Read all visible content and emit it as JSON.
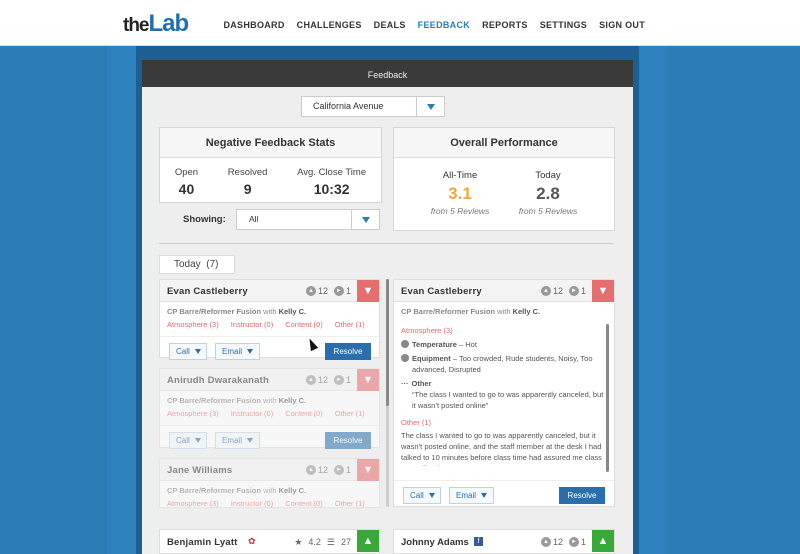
{
  "brand": {
    "the": "the",
    "lab": "Lab"
  },
  "nav": [
    "DASHBOARD",
    "CHALLENGES",
    "DEALS",
    "FEEDBACK",
    "REPORTS",
    "SETTINGS",
    "SIGN OUT"
  ],
  "modal": {
    "title": "Feedback"
  },
  "location": {
    "selected": "California Avenue"
  },
  "negative": {
    "title": "Negative Feedback Stats",
    "open_label": "Open",
    "open_value": "40",
    "resolved_label": "Resolved",
    "resolved_value": "9",
    "close_label": "Avg. Close Time",
    "close_value": "10:32"
  },
  "performance": {
    "title": "Overall Performance",
    "alltime_label": "All-Time",
    "alltime_value": "3.1",
    "alltime_from": "from 5 Reviews",
    "today_label": "Today",
    "today_value": "2.8",
    "today_from": "from 5 Reviews"
  },
  "showing": {
    "label": "Showing:",
    "value": "All"
  },
  "today_tab": {
    "label": "Today",
    "count": "(7)"
  },
  "cards": [
    {
      "name": "Evan Castleberry",
      "likes": "12",
      "comments": "1",
      "class": "CP Barre/Reformer Fusion",
      "with": "with",
      "instructor": "Kelly C.",
      "cats": [
        "Atmosphere (3)",
        "Instructor (0)",
        "Content (0)",
        "Other (1)"
      ]
    },
    {
      "name": "Anirudh Dwarakanath",
      "likes": "12",
      "comments": "1",
      "class": "CP Barre/Reformer Fusion",
      "with": "with",
      "instructor": "Kelly C.",
      "cats": [
        "Atmosphere (3)",
        "Instructor (0)",
        "Content (0)",
        "Other (1)"
      ]
    },
    {
      "name": "Jane Williams",
      "likes": "12",
      "comments": "1",
      "class": "CP Barre/Reformer Fusion",
      "with": "with",
      "instructor": "Kelly C.",
      "cats": [
        "Atmosphere (3)",
        "Instructor (0)",
        "Content (0)",
        "Other (1)"
      ]
    }
  ],
  "actions": {
    "call": "Call",
    "email": "Email",
    "resolve": "Resolve"
  },
  "detail": {
    "name": "Evan Castleberry",
    "likes": "12",
    "comments": "1",
    "class": "CP Barre/Reformer Fusion",
    "with": "with",
    "instructor": "Kelly C.",
    "cat1": "Atmosphere (3)",
    "temp_label": "Temperature",
    "temp_value": "– Hot",
    "equip_label": "Equipment",
    "equip_value": "– Too crowded, Rude students, Noisy, Too advanced, Disrupted",
    "other_label": "Other",
    "other_quote": "“The class I wanted to go to was apparently canceled, but it wasn’t posted online”",
    "cat2": "Other (1)",
    "other_text": "The class I wanted to go to was apparently canceled, but it wasn’t posted online, and the staff member at the desk I had talked to 10 minutes before class time had assured me class was still going on"
  },
  "bottom": [
    {
      "name": "Benjamin Lyatt",
      "rating": "4.2",
      "reviews": "27"
    },
    {
      "name": "Johnny Adams",
      "likes": "12",
      "comments": "1"
    }
  ],
  "colors": {
    "accent": "#2a7db5",
    "negative": "#e56e6e",
    "positive": "#38a838",
    "rating": "#f0a93b"
  }
}
